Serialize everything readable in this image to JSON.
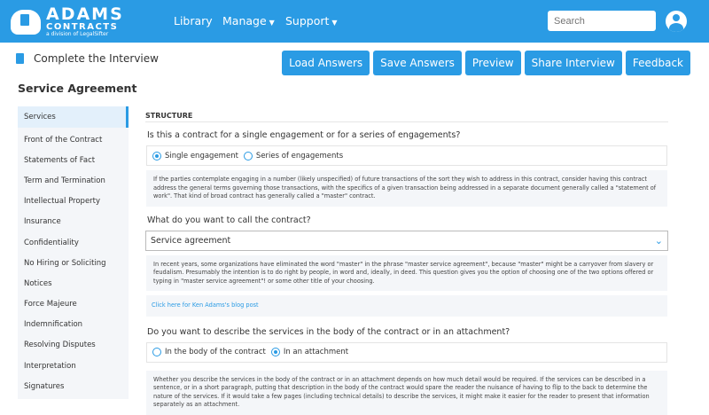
{
  "nav": {
    "brand": "ADAMS",
    "brand_sub": "CONTRACTS",
    "brand_tag": "a division of LegalSifter",
    "links": [
      "Library",
      "Manage",
      "Support"
    ],
    "search_placeholder": "Search"
  },
  "page": {
    "title": "Complete the Interview",
    "agreement": "Service Agreement",
    "buttons": [
      "Load Answers",
      "Save Answers",
      "Preview",
      "Share Interview",
      "Feedback"
    ]
  },
  "sidebar": [
    "Services",
    "Front of the Contract",
    "Statements of Fact",
    "Term and Termination",
    "Intellectual Property",
    "Insurance",
    "Confidentiality",
    "No Hiring or Soliciting",
    "Notices",
    "Force Majeure",
    "Indemnification",
    "Resolving Disputes",
    "Interpretation",
    "Signatures"
  ],
  "main": {
    "section": "STRUCTURE",
    "q1": "Is this a contract for a single engagement or for a series of engagements?",
    "q1_options": [
      "Single engagement",
      "Series of engagements"
    ],
    "q1_help": "If the parties contemplate engaging in a number (likely unspecified) of future transactions of the sort they wish to address in this contract, consider having this contract address the general terms governing those transactions, with the specifics of a given transaction being addressed in a separate document generally called a \"statement of work\". That kind of broad contract has generally called a \"master\" contract.",
    "q2": "What do you want to call the contract?",
    "q2_value": "Service agreement",
    "q2_help": "In recent years, some organizations have eliminated the word \"master\" in the phrase \"master service agreement\", because \"master\" might be a carryover from slavery or feudalism. Presumably the intention is to do right by people, in word and, ideally, in deed. This question gives you the option of choosing one of the two options offered or typing in \"master service agreement\"! or some other title of your choosing.",
    "q2_link": "Click here for Ken Adams's blog post",
    "q3": "Do you want to describe the services in the body of the contract or in an attachment?",
    "q3_options": [
      "In the body of the contract",
      "In an attachment"
    ],
    "q3_help": "Whether you describe the services in the body of the contract or in an attachment depends on how much detail would be required. If the services can be described in a sentence, or in a short paragraph, putting that description in the body of the contract would spare the reader the nuisance of having to flip to the back to determine the nature of the services. If it would take a few pages (including technical details) to describe the services, it might make it easier for the reader to present that information separately as an attachment."
  }
}
